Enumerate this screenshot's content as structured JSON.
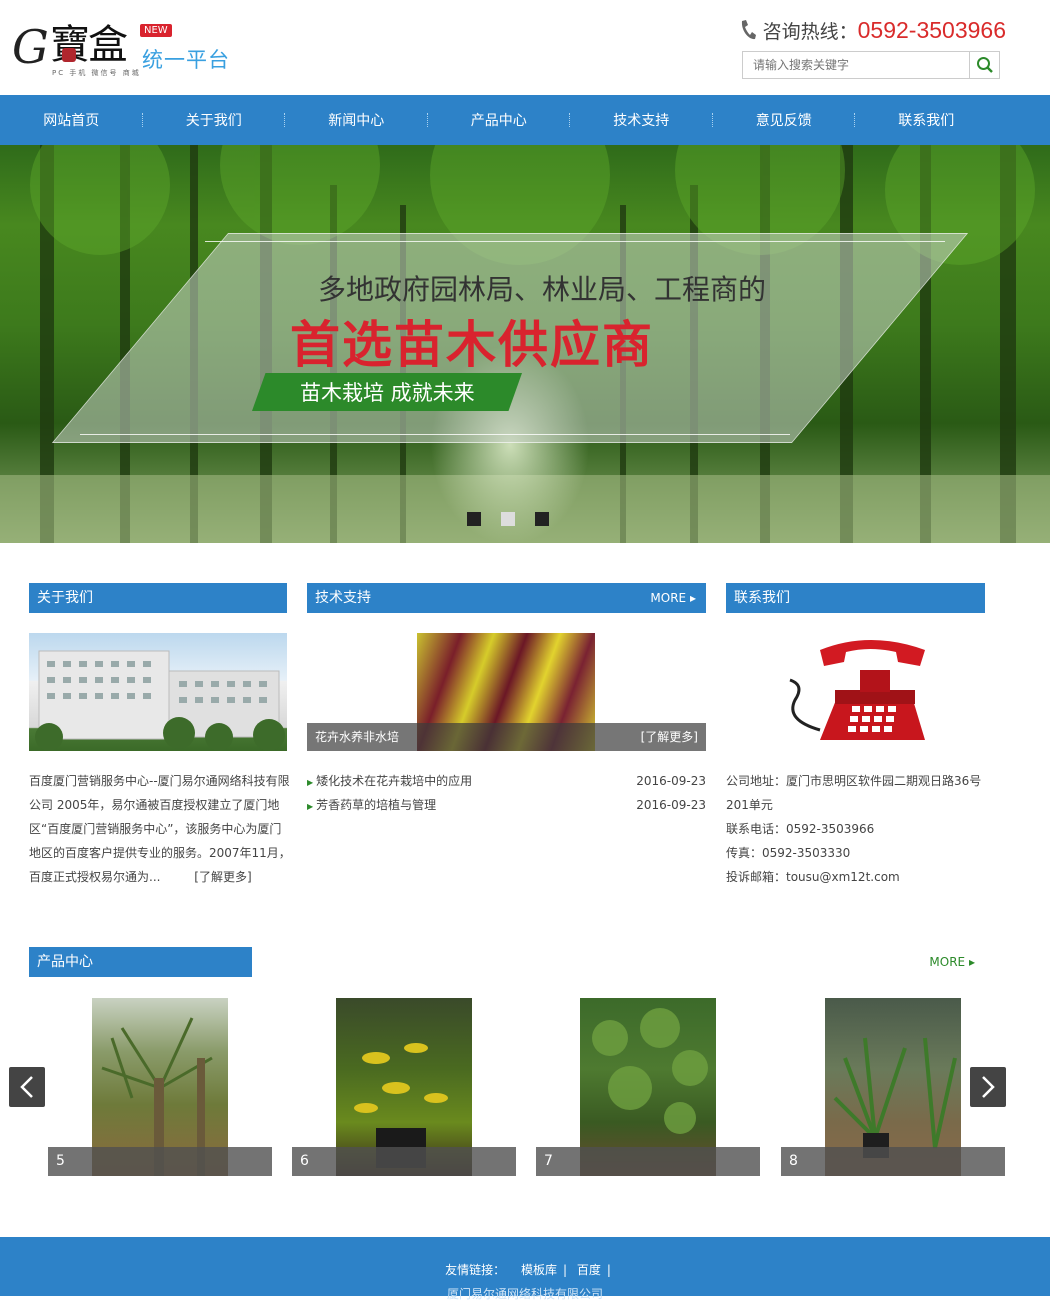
{
  "header": {
    "logo_letter": "G",
    "logo_name": "寶盒",
    "logo_new": "NEW",
    "logo_platform": "统一平台",
    "logo_sub": "PC 手机 微信号 商城",
    "hotline_label": "咨询热线：",
    "hotline_number": "0592-3503966",
    "search_placeholder": "请输入搜索关键字"
  },
  "nav": [
    "网站首页",
    "关于我们",
    "新闻中心",
    "产品中心",
    "技术支持",
    "意见反馈",
    "联系我们"
  ],
  "banner": {
    "line1": "多地政府园林局、林业局、工程商的",
    "line2": "首选苗木供应商",
    "ribbon": "苗木栽培 成就未来",
    "slides": 3,
    "active_slide": 2
  },
  "about": {
    "title": "关于我们",
    "text": "百度厦门营销服务中心--厦门易尔通网络科技有限公司 2005年，易尔通被百度授权建立了厦门地区“百度厦门营销服务中心”，该服务中心为厦门地区的百度客户提供专业的服务。2007年11月，百度正式授权易尔通为...",
    "more": "[了解更多]"
  },
  "tech": {
    "title": "技术支持",
    "more": "MORE",
    "caption": "花卉水养非水培",
    "caption_more": "[了解更多]",
    "news": [
      {
        "title": "矮化技术在花卉栽培中的应用",
        "date": "2016-09-23"
      },
      {
        "title": "芳香药草的培植与管理",
        "date": "2016-09-23"
      }
    ]
  },
  "contact": {
    "title": "联系我们",
    "address": "公司地址：厦门市思明区软件园二期观日路36号201单元",
    "phone": "联系电话：0592-3503966",
    "fax": "传真：0592-3503330",
    "email": "投诉邮箱：tousu@xm12t.com"
  },
  "products": {
    "title": "产品中心",
    "more": "MORE",
    "items": [
      "5",
      "6",
      "7",
      "8"
    ]
  },
  "footer": {
    "links_label": "友情链接：",
    "links": [
      "模板库",
      "百度"
    ],
    "copyright": "厦门易尔通网络科技有限公司"
  },
  "colors": {
    "brand_blue": "#2d82c8",
    "accent_red": "#d9232e",
    "green": "#2c8a2a"
  }
}
